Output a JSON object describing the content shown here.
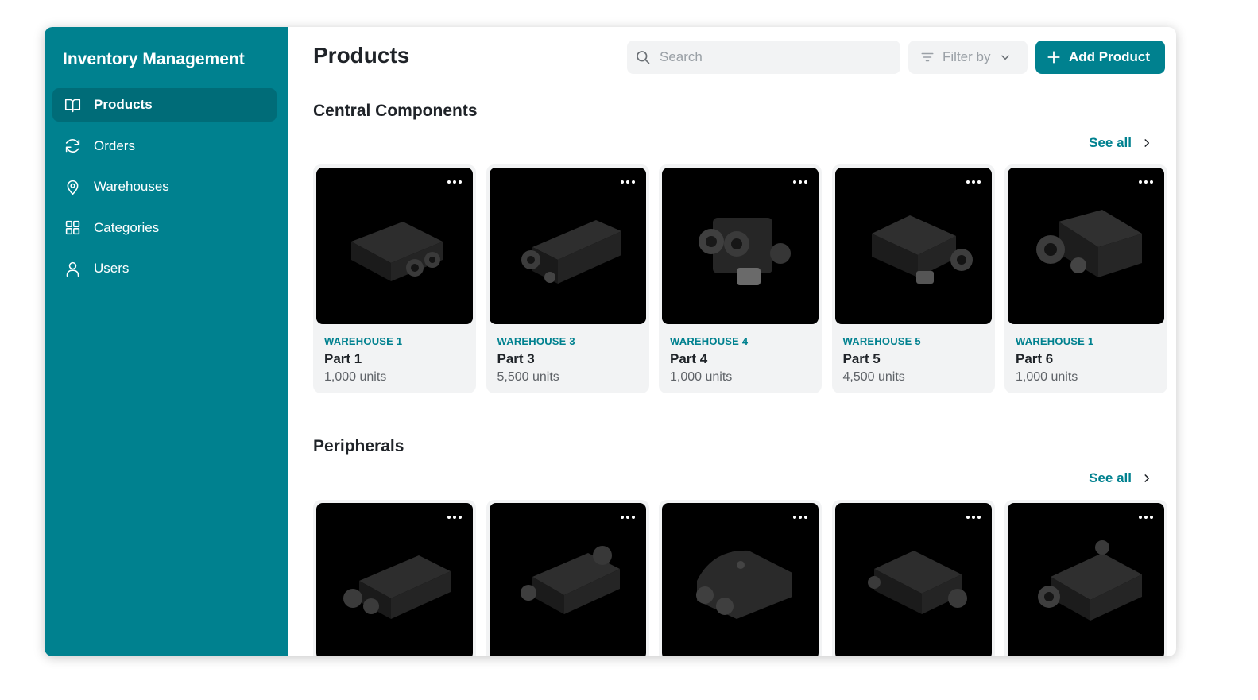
{
  "app": {
    "title": "Inventory Management"
  },
  "sidebar": {
    "items": [
      {
        "label": "Products",
        "icon": "book-open-icon",
        "active": true
      },
      {
        "label": "Orders",
        "icon": "refresh-icon",
        "active": false
      },
      {
        "label": "Warehouses",
        "icon": "map-pin-icon",
        "active": false
      },
      {
        "label": "Categories",
        "icon": "grid-icon",
        "active": false
      },
      {
        "label": "Users",
        "icon": "user-icon",
        "active": false
      }
    ]
  },
  "header": {
    "title": "Products",
    "search_placeholder": "Search",
    "filter_label": "Filter by",
    "add_label": "Add Product"
  },
  "colors": {
    "brand": "#00818f",
    "brand_dark": "#006c78",
    "card_bg": "#f2f3f4"
  },
  "sections": [
    {
      "title": "Central Components",
      "see_all": "See all",
      "cards": [
        {
          "warehouse": "WAREHOUSE 1",
          "name": "Part 1",
          "units": "1,000 units"
        },
        {
          "warehouse": "WAREHOUSE 3",
          "name": "Part 3",
          "units": "5,500 units"
        },
        {
          "warehouse": "WAREHOUSE 4",
          "name": "Part 4",
          "units": "1,000 units"
        },
        {
          "warehouse": "WAREHOUSE 5",
          "name": "Part 5",
          "units": "4,500 units"
        },
        {
          "warehouse": "WAREHOUSE 1",
          "name": "Part 6",
          "units": "1,000 units"
        }
      ]
    },
    {
      "title": "Peripherals",
      "see_all": "See all",
      "cards": [
        {
          "warehouse": "",
          "name": "",
          "units": ""
        },
        {
          "warehouse": "",
          "name": "",
          "units": ""
        },
        {
          "warehouse": "",
          "name": "",
          "units": ""
        },
        {
          "warehouse": "",
          "name": "",
          "units": ""
        },
        {
          "warehouse": "",
          "name": "",
          "units": ""
        }
      ]
    }
  ]
}
